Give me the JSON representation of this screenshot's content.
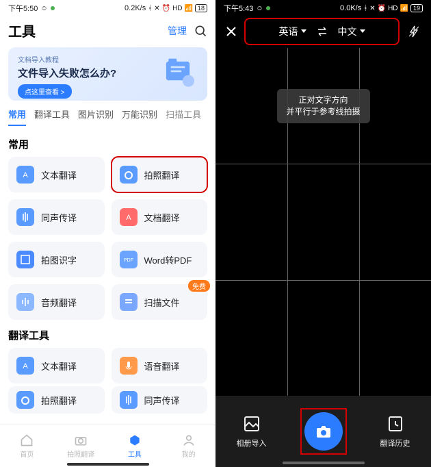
{
  "left": {
    "statusbar": {
      "time": "下午5:50",
      "speed": "0.2K/s",
      "battery": "18"
    },
    "title": "工具",
    "manage": "管理",
    "banner": {
      "small": "文档导入教程",
      "big": "文件导入失败怎么办?",
      "btn": "点这里查看 >"
    },
    "tabs": [
      "常用",
      "翻译工具",
      "图片识别",
      "万能识别",
      "扫描工具"
    ],
    "section1": "常用",
    "tools1": [
      {
        "label": "文本翻译",
        "color": "blue"
      },
      {
        "label": "拍照翻译",
        "color": "blue",
        "highlight": true
      },
      {
        "label": "同声传译",
        "color": "blue"
      },
      {
        "label": "文档翻译",
        "color": "red"
      },
      {
        "label": "拍图识字",
        "color": "blue"
      },
      {
        "label": "Word转PDF",
        "color": "blue-pdf"
      },
      {
        "label": "音频翻译",
        "color": "blue-light"
      },
      {
        "label": "扫描文件",
        "color": "blue-scan",
        "badge": "免费"
      }
    ],
    "section2": "翻译工具",
    "tools2": [
      {
        "label": "文本翻译",
        "color": "blue"
      },
      {
        "label": "语音翻译",
        "color": "orange"
      },
      {
        "label": "拍照翻译",
        "color": "blue"
      },
      {
        "label": "同声传译",
        "color": "blue"
      }
    ],
    "nav": [
      {
        "label": "首页"
      },
      {
        "label": "拍照翻译"
      },
      {
        "label": "工具",
        "active": true
      },
      {
        "label": "我的"
      }
    ]
  },
  "right": {
    "statusbar": {
      "time": "下午5:43",
      "speed": "0.0K/s",
      "battery": "19"
    },
    "langFrom": "英语",
    "langTo": "中文",
    "hint1": "正对文字方向",
    "hint2": "并平行于参考线拍摄",
    "bottom": {
      "album": "相册导入",
      "history": "翻译历史"
    }
  }
}
